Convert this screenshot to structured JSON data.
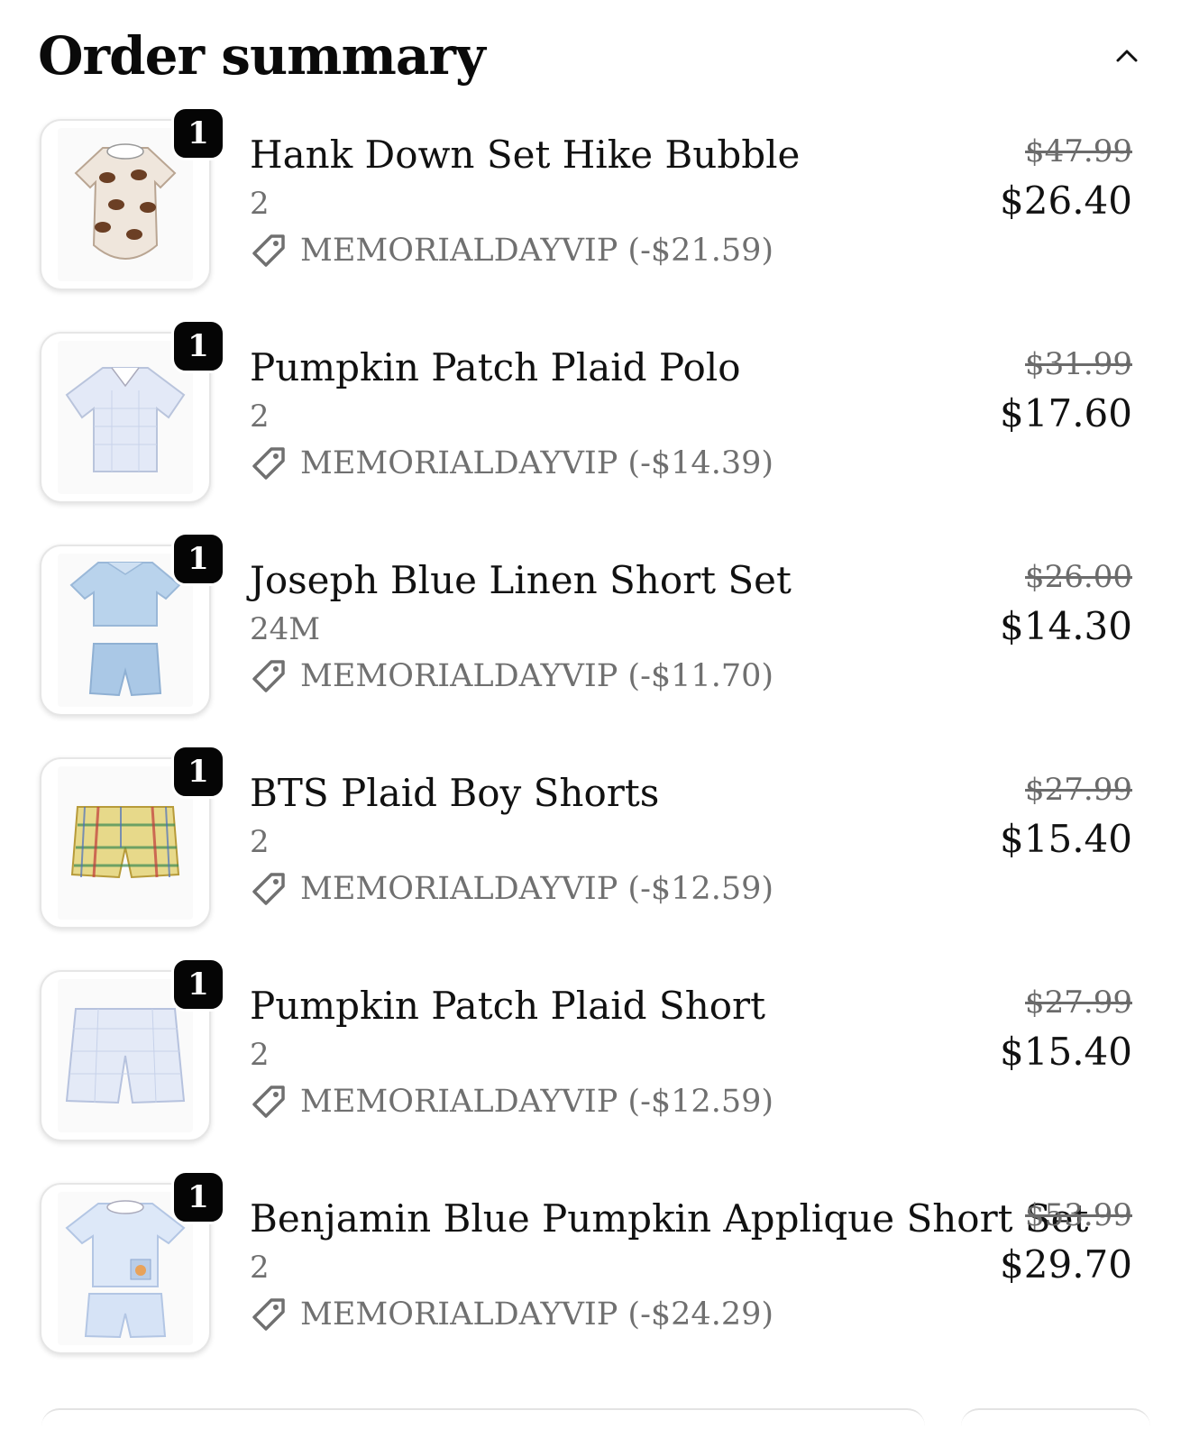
{
  "header": {
    "title": "Order summary",
    "toggle_icon": "chevron-up-icon"
  },
  "items": [
    {
      "name": "Hank Down Set Hike Bubble",
      "variant": "2",
      "quantity": "1",
      "discount_code": "MEMORIALDAYVIP (-$21.59)",
      "original_price": "$47.99",
      "final_price": "$26.40",
      "image": "football-print-bubble-romper"
    },
    {
      "name": "Pumpkin Patch Plaid Polo",
      "variant": "2",
      "quantity": "1",
      "discount_code": "MEMORIALDAYVIP (-$14.39)",
      "original_price": "$31.99",
      "final_price": "$17.60",
      "image": "blue-plaid-polo-shirt"
    },
    {
      "name": "Joseph Blue Linen Short Set",
      "variant": "24M",
      "quantity": "1",
      "discount_code": "MEMORIALDAYVIP (-$11.70)",
      "original_price": "$26.00",
      "final_price": "$14.30",
      "image": "blue-linen-short-set"
    },
    {
      "name": "BTS Plaid Boy Shorts",
      "variant": "2",
      "quantity": "1",
      "discount_code": "MEMORIALDAYVIP (-$12.59)",
      "original_price": "$27.99",
      "final_price": "$15.40",
      "image": "multicolor-plaid-shorts"
    },
    {
      "name": "Pumpkin Patch Plaid Short",
      "variant": "2",
      "quantity": "1",
      "discount_code": "MEMORIALDAYVIP (-$12.59)",
      "original_price": "$27.99",
      "final_price": "$15.40",
      "image": "blue-plaid-shorts"
    },
    {
      "name": "Benjamin Blue Pumpkin Applique Short Set",
      "variant": "2",
      "quantity": "1",
      "discount_code": "MEMORIALDAYVIP (-$24.29)",
      "original_price": "$53.99",
      "final_price": "$29.70",
      "image": "blue-pumpkin-applique-set"
    }
  ]
}
